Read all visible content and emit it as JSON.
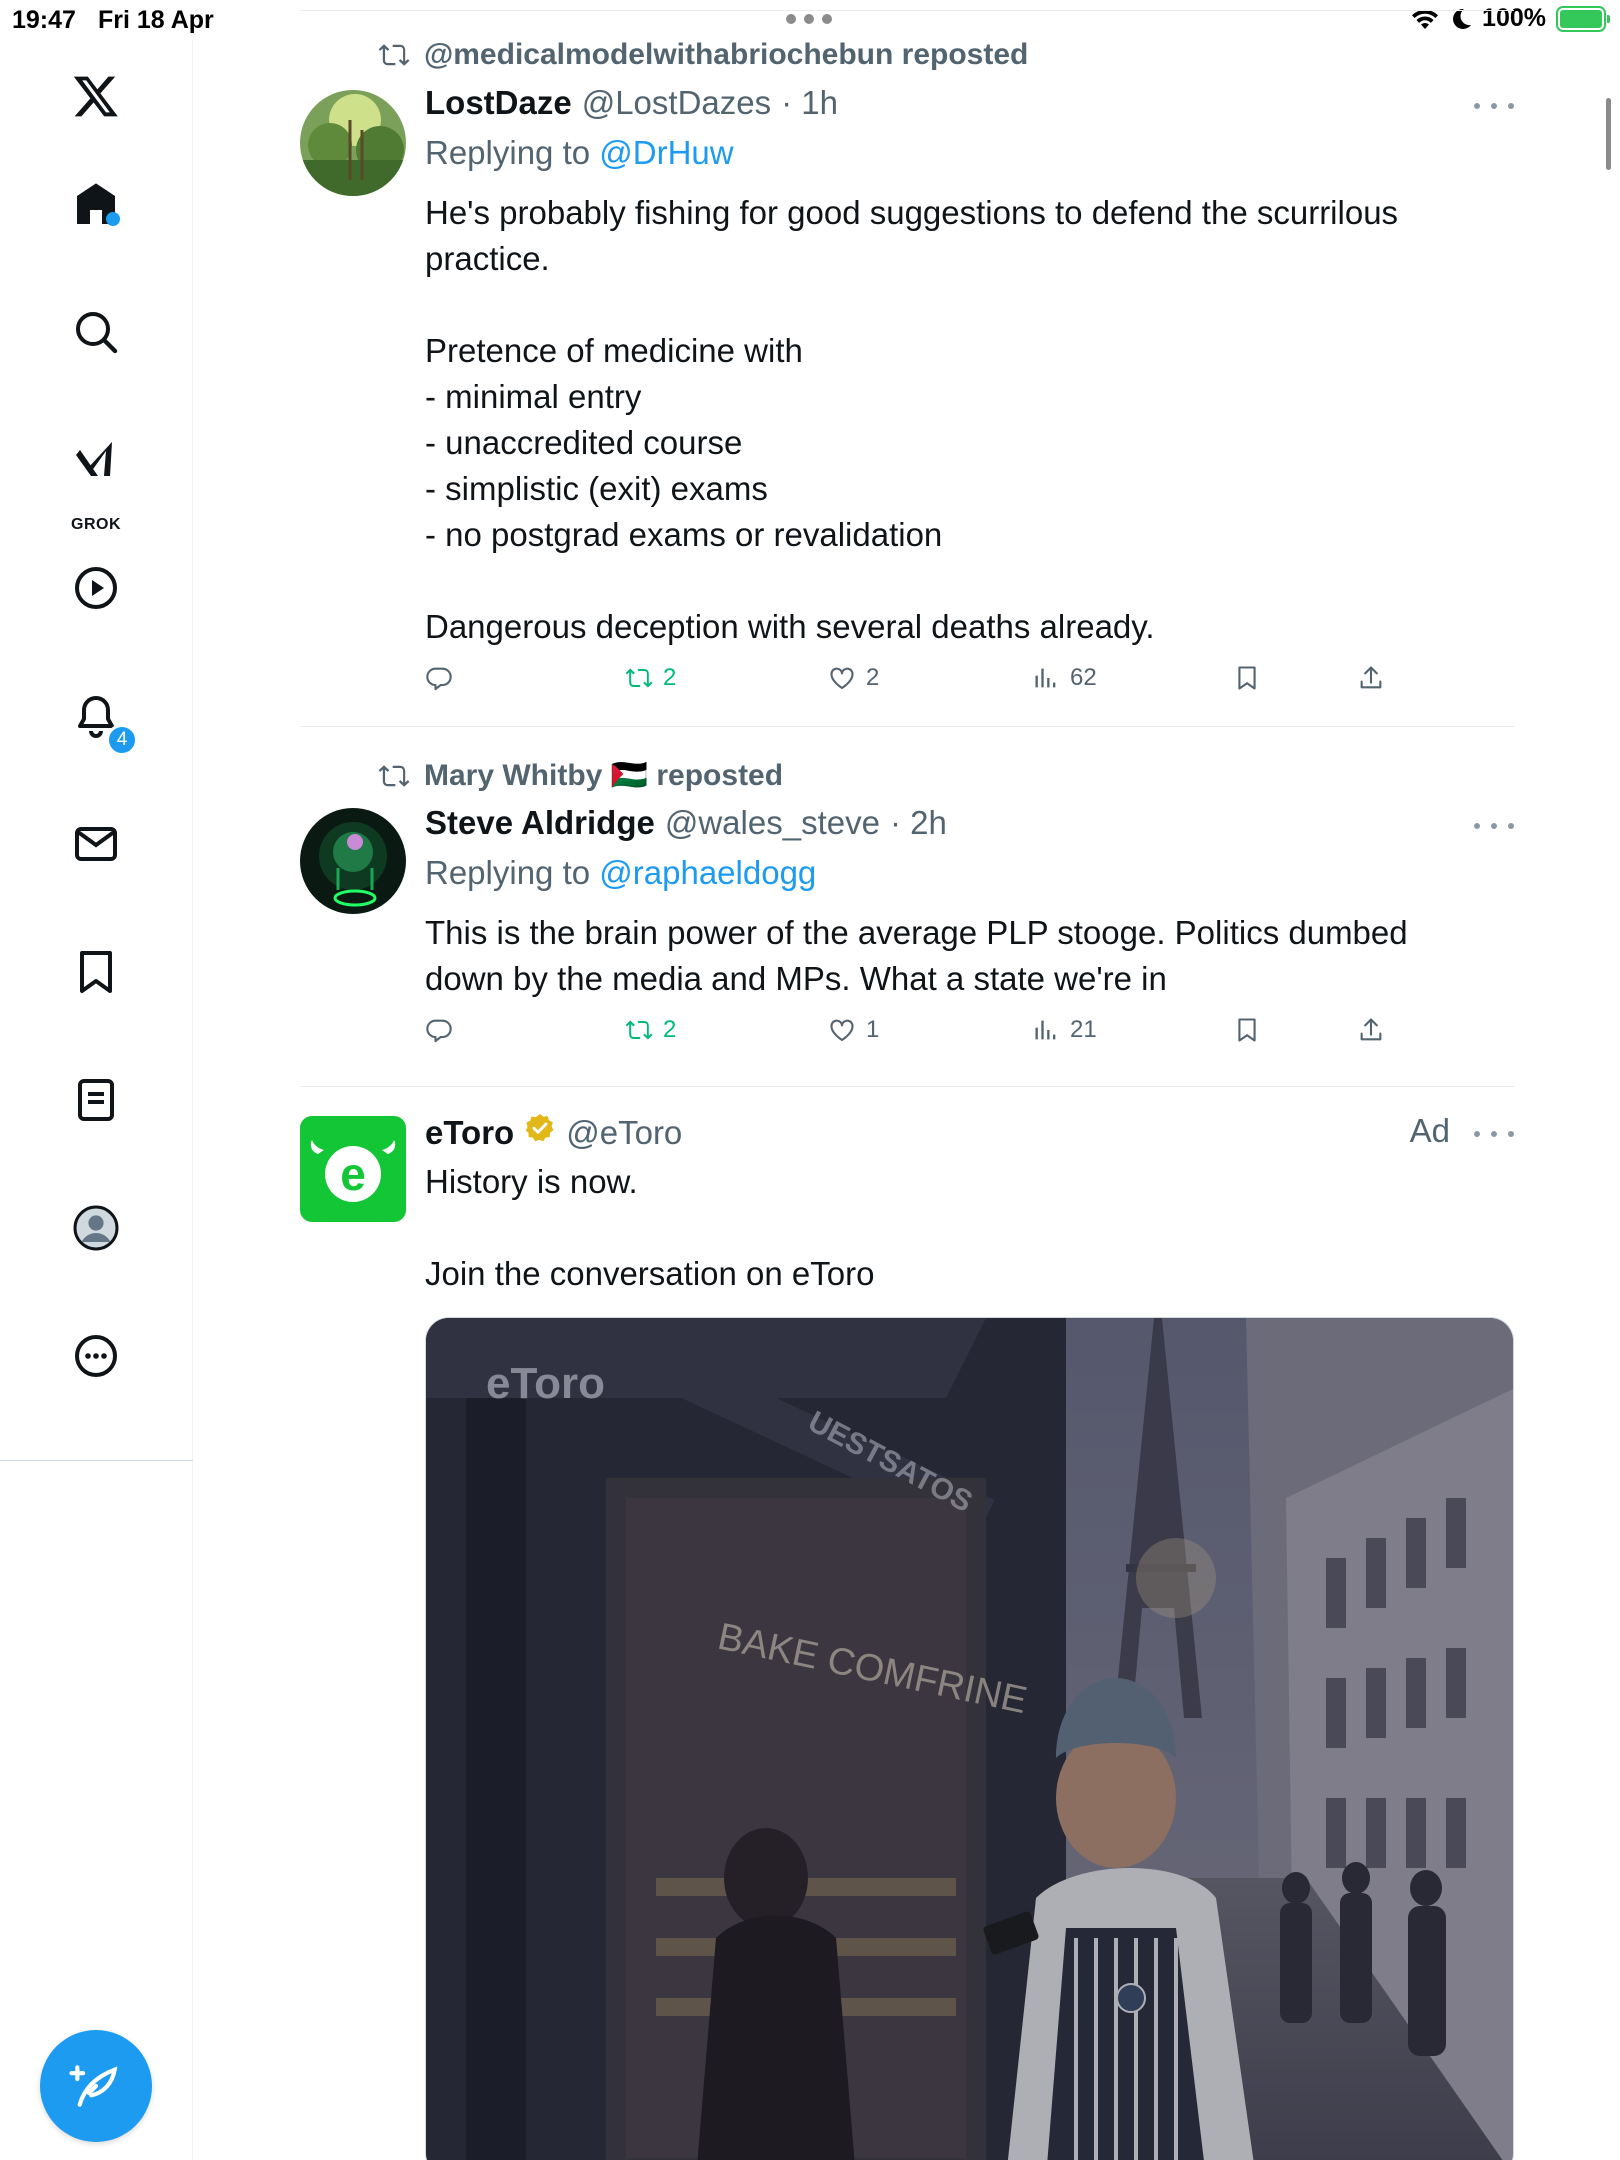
{
  "status_bar": {
    "time": "19:47",
    "date": "Fri 18 Apr",
    "battery_pct": "100%",
    "battery_level": 1.0
  },
  "sidebar": {
    "items": [
      {
        "name": "x-logo",
        "icon": "x-logo-icon"
      },
      {
        "name": "home",
        "icon": "home-icon",
        "has_dot": true
      },
      {
        "name": "explore",
        "icon": "search-icon"
      },
      {
        "name": "grok",
        "icon": "grok-icon",
        "label": "GROK"
      },
      {
        "name": "videos",
        "icon": "play-icon"
      },
      {
        "name": "notifications",
        "icon": "bell-icon",
        "badge": "4"
      },
      {
        "name": "messages",
        "icon": "mail-icon"
      },
      {
        "name": "bookmarks",
        "icon": "bookmark-icon"
      },
      {
        "name": "lists",
        "icon": "list-icon"
      },
      {
        "name": "profile",
        "icon": "profile-icon"
      },
      {
        "name": "more",
        "icon": "more-icon"
      }
    ],
    "compose_icon": "compose-icon"
  },
  "tweets": [
    {
      "repost_by": "@medicalmodelwithabriochebun reposted",
      "display_name": "LostDaze",
      "handle": "@LostDazes",
      "time": "· 1h",
      "reply_prefix": "Replying to",
      "reply_to": "@DrHuw",
      "lines": [
        "He's probably fishing for good suggestions to defend the scurrilous",
        "practice.",
        "",
        "Pretence of medicine with",
        "- minimal entry",
        "- unaccredited course",
        "- simplistic (exit) exams",
        "- no postgrad exams or revalidation",
        "",
        "Dangerous deception with several deaths already."
      ],
      "reposts": "2",
      "likes": "2",
      "views": "62"
    },
    {
      "repost_by": "Mary Whitby 🇵🇸 reposted",
      "display_name": "Steve Aldridge",
      "handle": "@wales_steve",
      "time": "· 2h",
      "reply_prefix": "Replying to",
      "reply_to": "@raphaeldogg",
      "lines": [
        "This is the brain power of the average PLP stooge. Politics dumbed",
        "down by the media and MPs. What a state we're in"
      ],
      "reposts": "2",
      "likes": "1",
      "views": "21"
    },
    {
      "display_name": "eToro",
      "handle": "@eToro",
      "ad_label": "Ad",
      "lines": [
        "History is now.",
        "",
        "Join the conversation on eToro"
      ],
      "media": {
        "logo_text": "eToro",
        "sign_text": "UESTSATOS",
        "window_text": "BAKE COMFRINE"
      }
    }
  ],
  "colors": {
    "accent": "#1d9bf0",
    "repost_green": "#00ba7c",
    "secondary_text": "#536471",
    "etoro_green": "#13c636"
  }
}
